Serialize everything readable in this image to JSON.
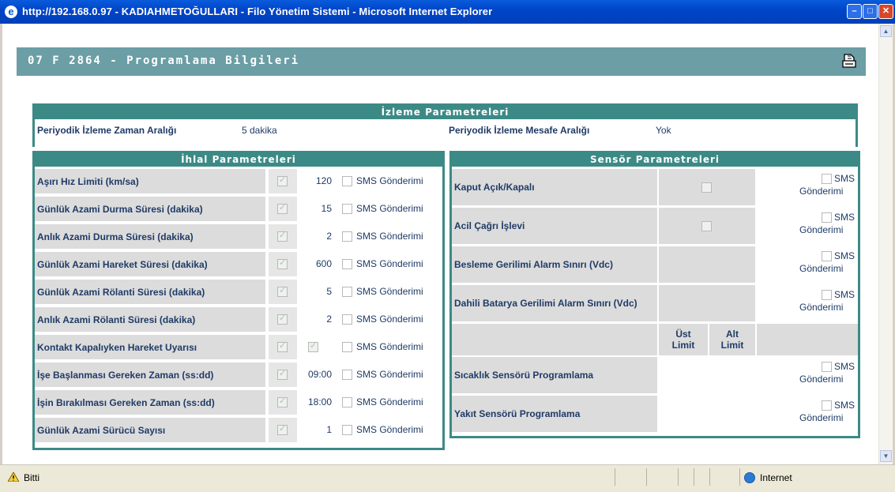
{
  "window": {
    "title": "http://192.168.0.97 - KADIAHMETOĞULLARI - Filo Yönetim Sistemi - Microsoft Internet Explorer",
    "minimize": "–",
    "maximize": "□",
    "close": "✕"
  },
  "page": {
    "title": "07 F 2864 - Programlama Bilgileri"
  },
  "izleme": {
    "heading": "İzleme Parametreleri",
    "zaman_label": "Periyodik İzleme Zaman Aralığı",
    "zaman_value": "5 dakika",
    "mesafe_label": "Periyodik İzleme Mesafe Aralığı",
    "mesafe_value": "Yok"
  },
  "ihlal": {
    "heading": "İhlal Parametreleri",
    "rows": [
      {
        "label": "Aşırı Hız Limiti (km/sa)",
        "value": "120",
        "sms": "SMS Gönderimi",
        "checked": true
      },
      {
        "label": "Günlük Azami Durma Süresi (dakika)",
        "value": "15",
        "sms": "SMS Gönderimi",
        "checked": true
      },
      {
        "label": "Anlık Azami Durma Süresi (dakika)",
        "value": "2",
        "sms": "SMS Gönderimi",
        "checked": true
      },
      {
        "label": "Günlük Azami Hareket Süresi (dakika)",
        "value": "600",
        "sms": "SMS Gönderimi",
        "checked": true
      },
      {
        "label": "Günlük Azami Rölanti Süresi (dakika)",
        "value": "5",
        "sms": "SMS Gönderimi",
        "checked": true
      },
      {
        "label": "Anlık Azami Rölanti Süresi (dakika)",
        "value": "2",
        "sms": "SMS Gönderimi",
        "checked": true
      },
      {
        "label": "Kontakt Kapalıyken Hareket Uyarısı",
        "value": "",
        "sms": "SMS Gönderimi",
        "checked": true
      },
      {
        "label": "İşe Başlanması Gereken Zaman (ss:dd)",
        "value": "09:00",
        "sms": "SMS Gönderimi",
        "checked": true
      },
      {
        "label": "İşin Bırakılması Gereken Zaman (ss:dd)",
        "value": "18:00",
        "sms": "SMS Gönderimi",
        "checked": true
      },
      {
        "label": "Günlük Azami Sürücü Sayısı",
        "value": "1",
        "sms": "SMS Gönderimi",
        "checked": true
      }
    ]
  },
  "sensor": {
    "heading": "Sensör Parametreleri",
    "sms_line1": "SMS",
    "sms_line2": "Gönderimi",
    "rows": [
      {
        "label": "Kaput Açık/Kapalı"
      },
      {
        "label": "Acil Çağrı İşlevi"
      },
      {
        "label": "Besleme Gerilimi Alarm Sınırı (Vdc)"
      },
      {
        "label": "Dahili Batarya Gerilimi Alarm Sınırı (Vdc)"
      }
    ],
    "ust_limit": "Üst Limit",
    "alt_limit": "Alt Limit",
    "rows2": [
      {
        "label": "Sıcaklık Sensörü Programlama"
      },
      {
        "label": "Yakıt Sensörü Programlama"
      }
    ]
  },
  "status": {
    "text": "Bitti",
    "zone": "Internet"
  }
}
